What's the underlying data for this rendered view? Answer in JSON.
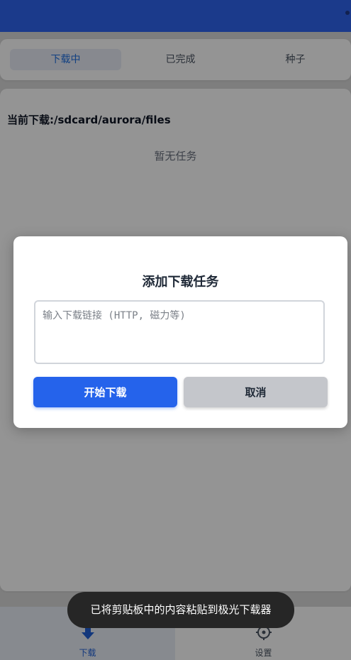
{
  "tabs": [
    {
      "label": "下载中",
      "active": true
    },
    {
      "label": "已完成",
      "active": false
    },
    {
      "label": "种子",
      "active": false
    }
  ],
  "content": {
    "path_label": "当前下载:/sdcard/aurora/files",
    "empty_text": "暂无任务"
  },
  "bottom_nav": [
    {
      "label": "下载",
      "icon": "download-icon",
      "active": true
    },
    {
      "label": "设置",
      "icon": "settings-icon",
      "active": false
    }
  ],
  "dialog": {
    "title": "添加下载任务",
    "input_placeholder": "输入下载链接 (HTTP, 磁力等)",
    "input_value": "",
    "primary_button": "开始下载",
    "secondary_button": "取消"
  },
  "toast": {
    "text": "已将剪贴板中的内容粘贴到极光下载器"
  },
  "colors": {
    "primary": "#2563eb",
    "topbar": "#2f64f0",
    "tab_active_text": "#1f6fe0"
  }
}
